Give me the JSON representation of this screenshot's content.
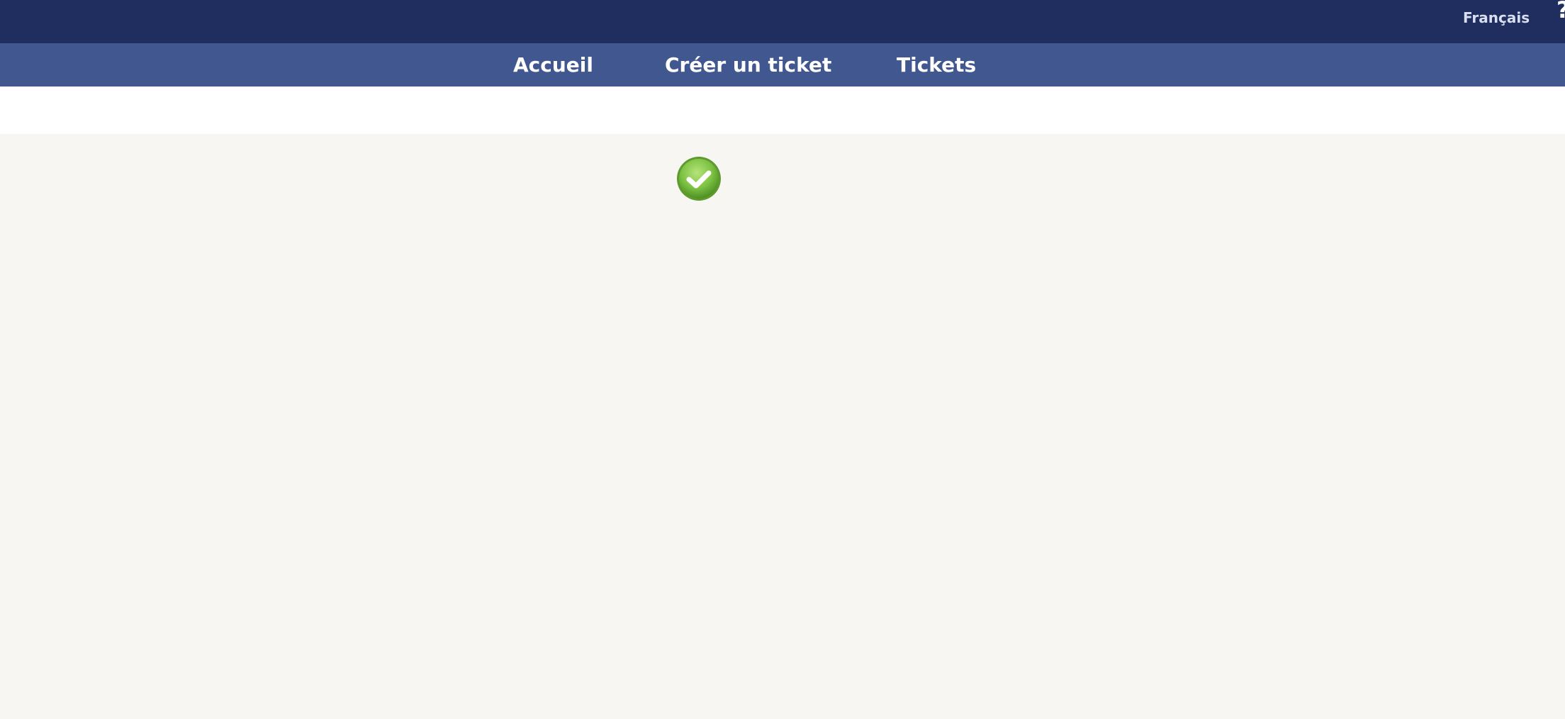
{
  "header": {
    "language_label": "Français",
    "help_icon": "help-icon",
    "colors": {
      "topbar": "#1f2e5f",
      "navbar": "#40578f",
      "background": "#f7f6f3"
    }
  },
  "nav": {
    "items": [
      {
        "label": "Accueil"
      },
      {
        "label": "Créer un ticket"
      },
      {
        "label": "Tickets"
      }
    ]
  },
  "content": {
    "status_icon": "check-circle-icon",
    "status_color": "#7cc242"
  }
}
